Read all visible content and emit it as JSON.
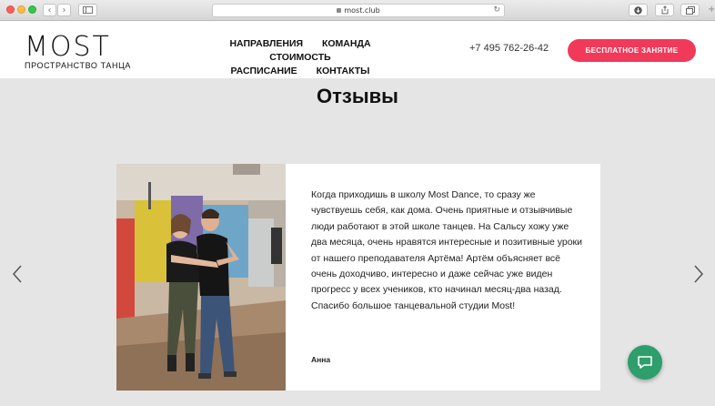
{
  "browser": {
    "url": "most.club"
  },
  "header": {
    "logo_main": "MOST",
    "logo_sub": "ПРОСТРАНСТВО ТАНЦА",
    "nav": [
      "НАПРАВЛЕНИЯ",
      "КОМАНДА",
      "СТОИМОСТЬ",
      "РАСПИСАНИЕ",
      "КОНТАКТЫ"
    ],
    "phone": "+7 495 762-26-42",
    "cta_label": "БЕСПЛАТНОЕ ЗАНЯТИЕ"
  },
  "reviews": {
    "title": "Отзывы",
    "text": "Когда приходишь в школу Most Dance, то сразу же чувствуешь себя, как дома. Очень приятные и отзывчивые люди работают в этой школе танцев. На Сальсу хожу уже два месяца, очень нравятся интересные и позитивные уроки от нашего преподавателя Артёма! Артём объясняет всё очень доходчиво, интересно и даже сейчас уже виден прогресс у всех учеников, кто начинал месяц-два назад. Спасибо большое танцевальной студии Most!",
    "author": "Анна"
  },
  "colors": {
    "accent": "#f1395a",
    "chat": "#2e9e6b",
    "background": "#e5e5e5"
  },
  "icons": {
    "prev": "chevron-left-icon",
    "next": "chevron-right-icon",
    "chat": "chat-bubble-icon"
  }
}
